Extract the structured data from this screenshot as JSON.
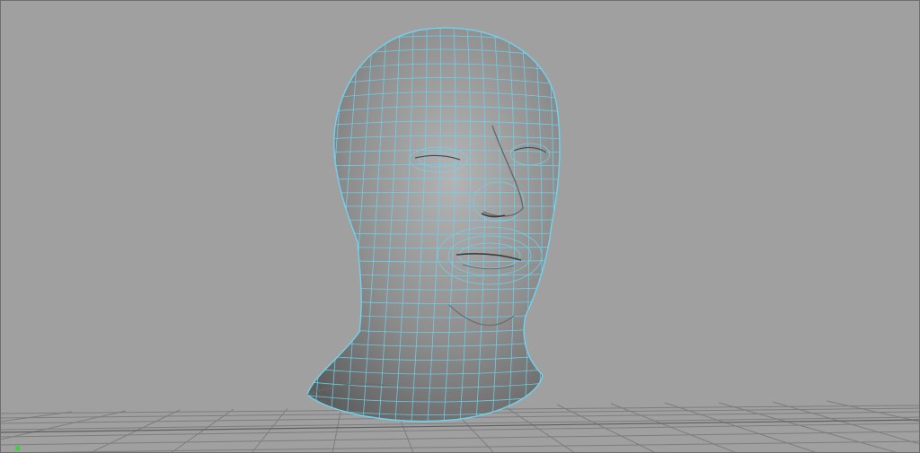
{
  "viewport": {
    "background": "#a0a0a0",
    "border_color": "#6e6e6e",
    "panel": "perspective-viewport"
  },
  "grid": {
    "visible": true,
    "line_color": "#7a7a7a",
    "major_line_color": "#5a5a5a"
  },
  "object": {
    "name": "head-mesh",
    "display": "shaded-with-wireframe",
    "selected": true,
    "shade_color": "#8f8f8f",
    "wire_color": "#6fd3ee"
  },
  "axis_indicator": {
    "color": "#3ed13e"
  }
}
